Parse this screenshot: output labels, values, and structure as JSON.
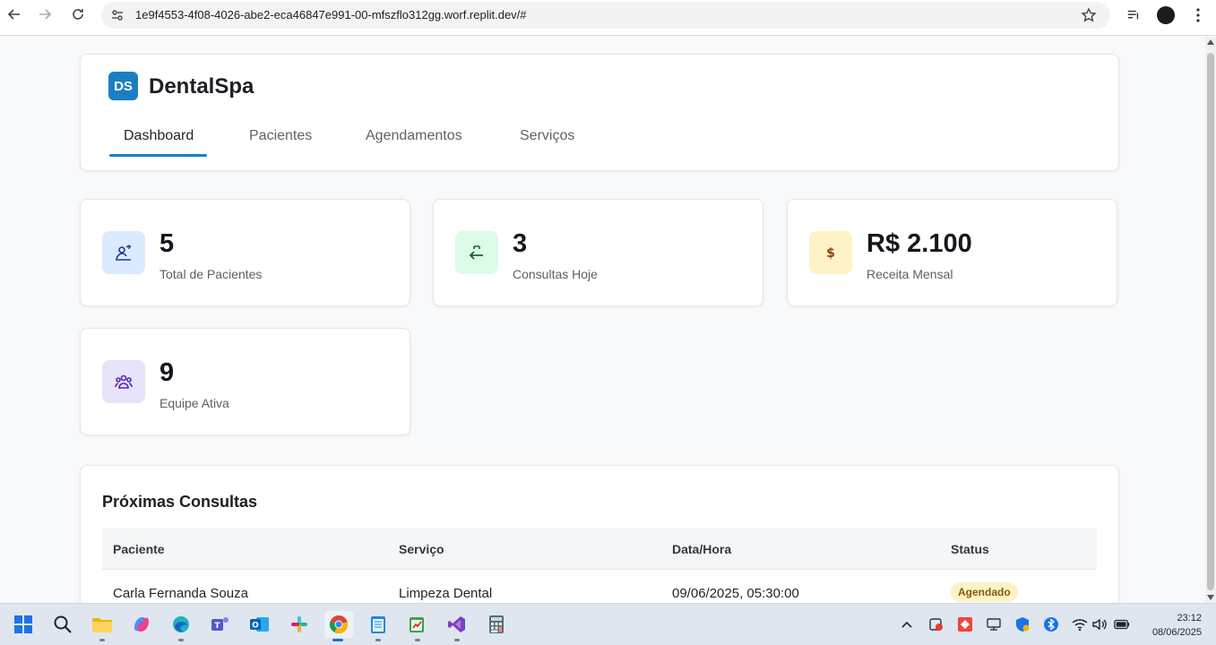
{
  "browser": {
    "url": "1e9f4553-4f08-4026-abe2-eca46847e991-00-mfszflo312gg.worf.replit.dev/#",
    "icons": [
      "back-icon",
      "forward-icon",
      "reload-icon",
      "site-info-icon",
      "bookmark-star-icon",
      "media-queue-icon",
      "profile-avatar",
      "menu-icon"
    ]
  },
  "header": {
    "logo_text": "DS",
    "brand": "DentalSpa",
    "tabs": [
      {
        "label": "Dashboard",
        "active": true
      },
      {
        "label": "Pacientes",
        "active": false
      },
      {
        "label": "Agendamentos",
        "active": false
      },
      {
        "label": "Serviços",
        "active": false
      }
    ]
  },
  "stats": [
    {
      "value": "5",
      "label": "Total de Pacientes",
      "icon": "patients-icon",
      "icon_bg": "#dbeafe",
      "icon_color": "#1e3a8a"
    },
    {
      "value": "3",
      "label": "Consultas Hoje",
      "icon": "calendar-arrow-icon",
      "icon_bg": "#dcfce7",
      "icon_color": "#166534"
    },
    {
      "value": "R$ 2.100",
      "label": "Receita Mensal",
      "icon": "dollar-icon",
      "icon_bg": "#fef3c7",
      "icon_color": "#92400e"
    },
    {
      "value": "9",
      "label": "Equipe Ativa",
      "icon": "team-icon",
      "icon_bg": "#e6e3fb",
      "icon_color": "#5b21b6"
    }
  ],
  "appointments": {
    "title": "Próximas Consultas",
    "columns": [
      "Paciente",
      "Serviço",
      "Data/Hora",
      "Status"
    ],
    "rows": [
      {
        "patient": "Carla Fernanda Souza",
        "service": "Limpeza Dental",
        "datetime": "09/06/2025, 05:30:00",
        "status": "Agendado"
      }
    ]
  },
  "taskbar": {
    "apps": [
      "windows-start-icon",
      "search-icon",
      "file-explorer-icon",
      "copilot-icon",
      "edge-icon",
      "teams-icon",
      "outlook-icon",
      "slack-icon",
      "chrome-icon",
      "notepad-icon",
      "spreadsheet-icon",
      "visual-studio-icon",
      "calculator-icon"
    ],
    "time": "23:12",
    "date": "08/06/2025"
  },
  "colors": {
    "accent": "#1a7fc1",
    "badge_bg": "#fdf3c8",
    "badge_text": "#8a5a00"
  }
}
